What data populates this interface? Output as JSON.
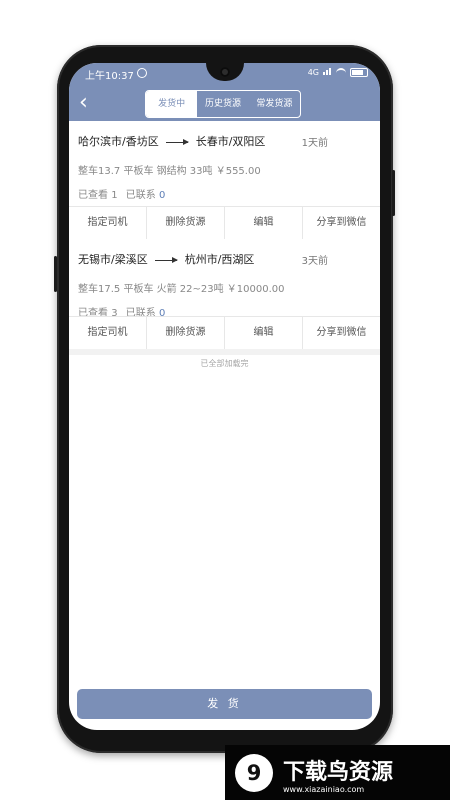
{
  "status": {
    "time": "上午10:37",
    "signal_label": "4G"
  },
  "header": {
    "tabs": [
      "发货中",
      "历史货源",
      "常发货源"
    ],
    "active_tab": 0
  },
  "shipments": [
    {
      "from": "哈尔滨市/香坊区",
      "to": "长春市/双阳区",
      "ago": "1天前",
      "details": "整车13.7 平板车 钢结构 33吨 ￥555.00",
      "viewed_label": "已查看",
      "viewed_count": "1",
      "contacted_label": "已联系",
      "contacted_count": "0",
      "actions": [
        "指定司机",
        "删除货源",
        "编辑",
        "分享到微信"
      ]
    },
    {
      "from": "无锡市/梁溪区",
      "to": "杭州市/西湖区",
      "ago": "3天前",
      "details": "整车17.5 平板车 火箭 22~23吨 ￥10000.00",
      "viewed_label": "已查看",
      "viewed_count": "3",
      "contacted_label": "已联系",
      "contacted_count": "0",
      "actions": [
        "指定司机",
        "删除货源",
        "编辑",
        "分享到微信"
      ]
    }
  ],
  "footer": {
    "loaded_text": "已全部加载完",
    "ship_button": "发 货"
  },
  "watermark": {
    "brand": "下载鸟资源",
    "site": "www.xiazainiao.com"
  },
  "colors": {
    "primary": "#7b8fb7",
    "link": "#5f7fb6"
  },
  "icons": [
    "back-icon",
    "alarm-icon",
    "signal-icon",
    "wifi-icon",
    "battery-icon",
    "arrow-right-icon",
    "brand-logo-icon"
  ]
}
